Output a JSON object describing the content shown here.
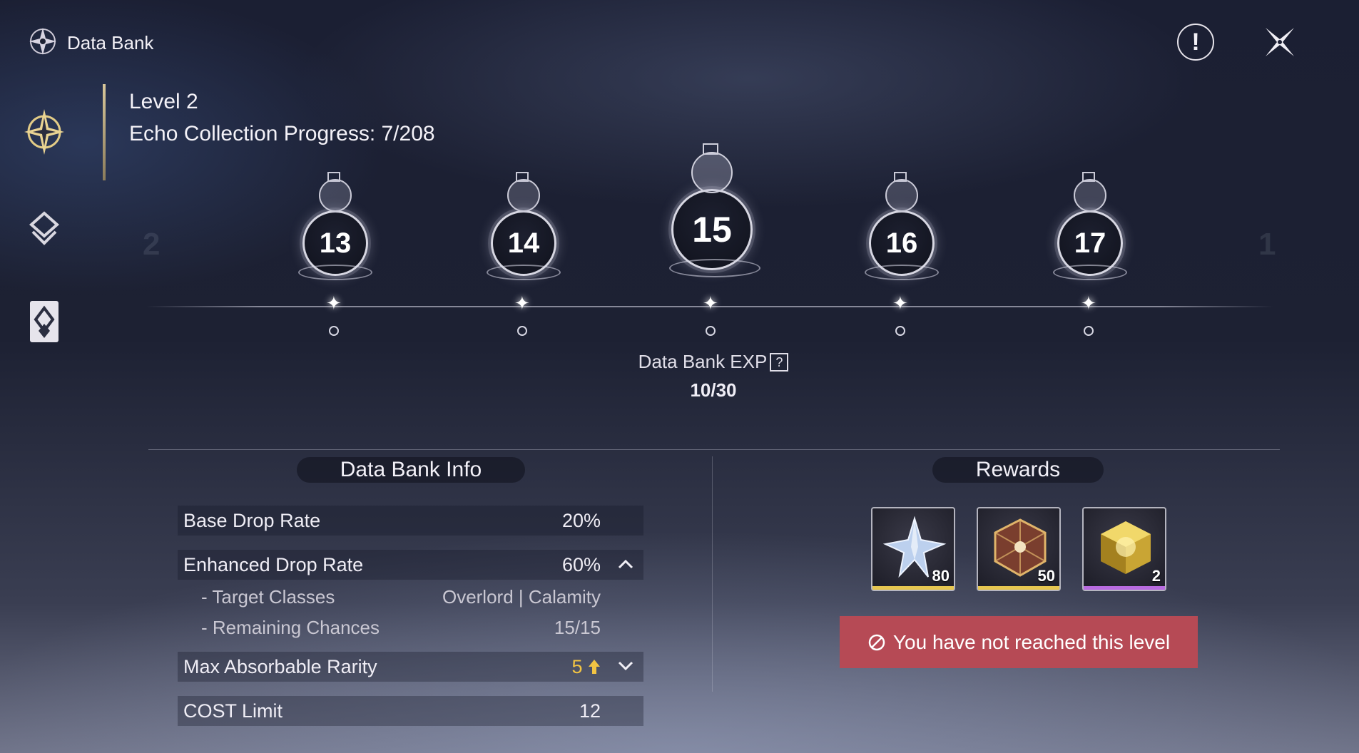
{
  "header": {
    "title": "Data Bank",
    "info_icon": "exclamation-icon",
    "close_icon": "close-x-icon"
  },
  "sidebar": {
    "items": [
      {
        "icon": "data-bank-compass-icon",
        "active": true
      },
      {
        "icon": "layers-diamond-icon",
        "active": false
      },
      {
        "icon": "card-diamond-icon",
        "active": false
      }
    ]
  },
  "status": {
    "level": "Level 2",
    "progress": "Echo Collection Progress: 7/208"
  },
  "timeline": {
    "nodes": [
      "13",
      "14",
      "15",
      "16",
      "17"
    ],
    "selected": "15",
    "ghost_left": "2",
    "ghost_right": "1"
  },
  "exp": {
    "label": "Data Bank EXP",
    "help": "?",
    "value": "10/30"
  },
  "info": {
    "title": "Data Bank Info",
    "base_drop_rate": {
      "label": "Base Drop Rate",
      "value": "20%"
    },
    "enhanced_drop_rate": {
      "label": "Enhanced Drop Rate",
      "value": "60%"
    },
    "target_classes": {
      "label": "- Target Classes",
      "value": "Overlord | Calamity"
    },
    "remaining_chances": {
      "label": "- Remaining Chances",
      "value": "15/15"
    },
    "max_rarity": {
      "label": "Max Absorbable Rarity",
      "value": "5"
    },
    "cost_limit": {
      "label": "COST Limit",
      "value": "12"
    }
  },
  "rewards": {
    "title": "Rewards",
    "items": [
      {
        "icon": "crystal-star-icon",
        "qty": "80",
        "rarity_color": "#e6c650"
      },
      {
        "icon": "dice-shell-icon",
        "qty": "50",
        "rarity_color": "#e6c650"
      },
      {
        "icon": "gold-cube-icon",
        "qty": "2",
        "rarity_color": "#b86be0"
      }
    ],
    "locked_message": "You have not reached this level"
  }
}
